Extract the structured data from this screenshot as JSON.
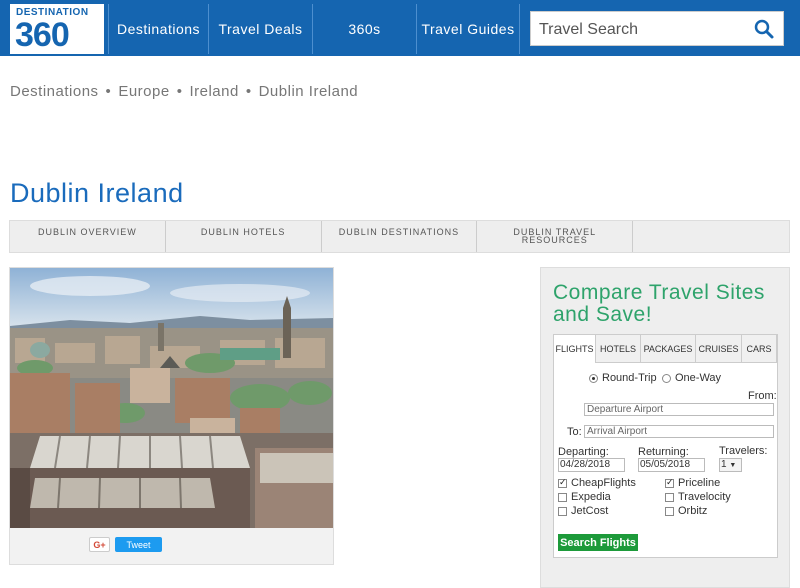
{
  "logo": {
    "top_text": "DESTINATION",
    "big_text": "360"
  },
  "nav": {
    "items": [
      "Destinations",
      "Travel Deals",
      "360s",
      "Travel Guides"
    ],
    "search_placeholder": "Travel Search"
  },
  "breadcrumb": [
    "Destinations",
    "Europe",
    "Ireland",
    "Dublin Ireland"
  ],
  "breadcrumb_sep": "•",
  "page_title": "Dublin Ireland",
  "subtabs": [
    "DUBLIN OVERVIEW",
    "DUBLIN HOTELS",
    "DUBLIN DESTINATIONS",
    "DUBLIN TRAVEL RESOURCES"
  ],
  "share": {
    "gplus": "G+",
    "tweet": "Tweet"
  },
  "compare": {
    "title": "Compare Travel Sites and Save!",
    "tabs": [
      "FLIGHTS",
      "HOTELS",
      "PACKAGES",
      "CRUISES",
      "CARS"
    ],
    "trip_types": [
      "Round-Trip",
      "One-Way"
    ],
    "from_label": "From:",
    "from_placeholder": "Departure Airport",
    "to_label": "To:",
    "to_placeholder": "Arrival Airport",
    "departing_label": "Departing:",
    "departing_value": "04/28/2018",
    "returning_label": "Returning:",
    "returning_value": "05/05/2018",
    "travelers_label": "Travelers:",
    "travelers_value": "1",
    "sites": [
      {
        "name": "CheapFlights",
        "checked": true
      },
      {
        "name": "Priceline",
        "checked": true
      },
      {
        "name": "Expedia",
        "checked": false
      },
      {
        "name": "Travelocity",
        "checked": false
      },
      {
        "name": "JetCost",
        "checked": false
      },
      {
        "name": "Orbitz",
        "checked": false
      }
    ],
    "button": "Search Flights"
  },
  "colors": {
    "header": "#1565b0",
    "title": "#1a6bbc",
    "compare_title": "#2ea36b",
    "button": "#1d9a3a"
  }
}
